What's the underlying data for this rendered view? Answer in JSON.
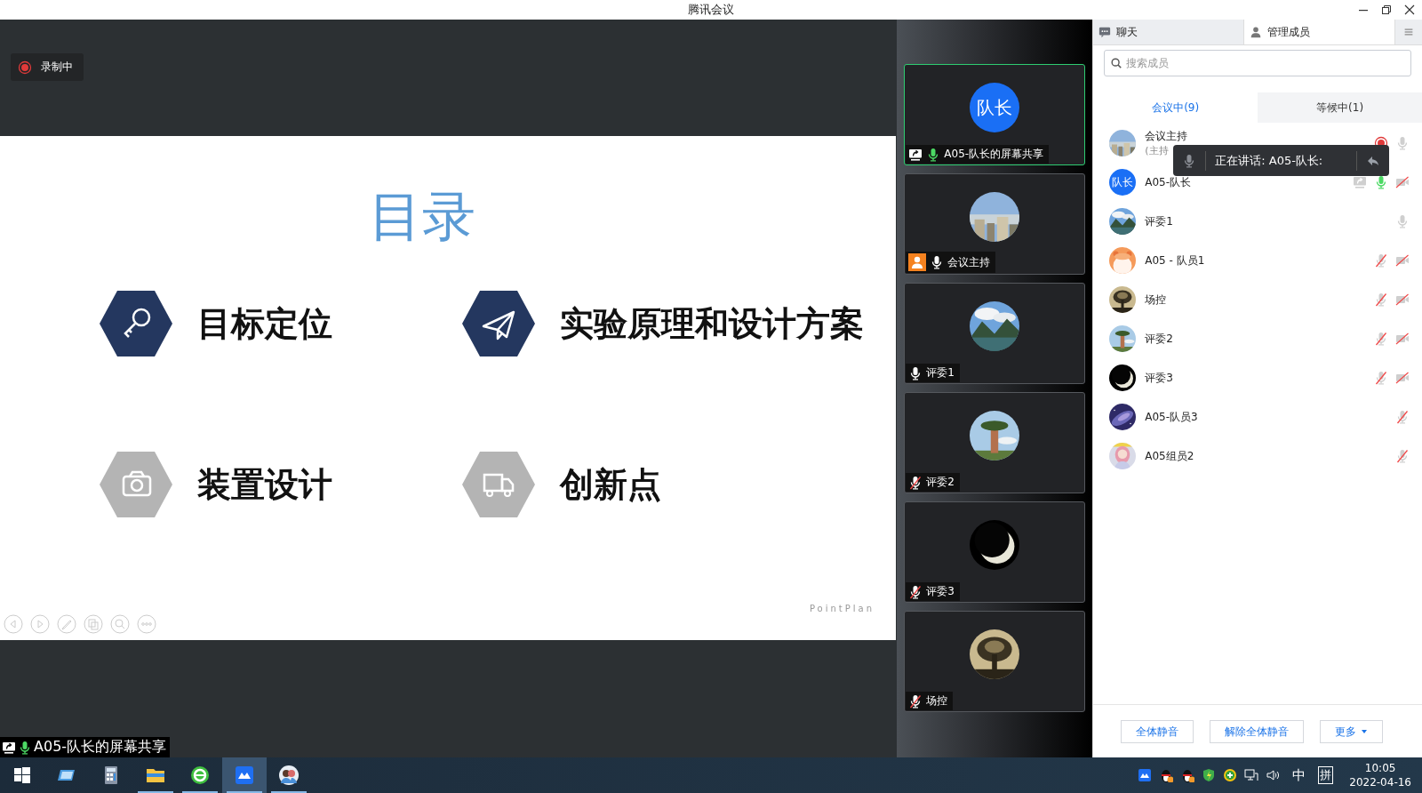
{
  "window": {
    "title": "腾讯会议"
  },
  "recording_badge": {
    "label": "录制中"
  },
  "slide": {
    "heading": "目录",
    "items": [
      {
        "kind": "key",
        "label": "目标定位",
        "color": "#24375f"
      },
      {
        "kind": "plane",
        "label": "实验原理和设计方案",
        "color": "#24375f"
      },
      {
        "kind": "camera",
        "label": "装置设计",
        "color": "#b4b4b4"
      },
      {
        "kind": "truck",
        "label": "创新点",
        "color": "#b4b4b4"
      }
    ],
    "logo": "PointPlan"
  },
  "share_label": {
    "text": "A05-队长的屏幕共享",
    "mic_active": true
  },
  "video_tiles": [
    {
      "name": "A05-队长的屏幕共享",
      "avatar": {
        "kind": "text",
        "text": "队长"
      },
      "speaking": true,
      "host": false,
      "sharing": true,
      "muted": false,
      "mic_active": true
    },
    {
      "name": "会议主持",
      "speaking": false,
      "host": true,
      "sharing": false,
      "muted": false,
      "mic_active": false
    },
    {
      "name": "评委1",
      "speaking": false,
      "host": false,
      "sharing": false,
      "muted": false,
      "mic_active": false
    },
    {
      "name": "评委2",
      "speaking": false,
      "host": false,
      "sharing": false,
      "muted": true,
      "mic_active": false
    },
    {
      "name": "评委3",
      "speaking": false,
      "host": false,
      "sharing": false,
      "muted": true,
      "mic_active": false
    },
    {
      "name": "场控",
      "speaking": false,
      "host": false,
      "sharing": false,
      "muted": true,
      "mic_active": false
    }
  ],
  "panel": {
    "tabs": [
      {
        "kind": "chat",
        "label": "聊天",
        "selected": false
      },
      {
        "kind": "members",
        "label": "管理成员",
        "selected": true
      }
    ],
    "search": {
      "placeholder": "搜索成员"
    },
    "subtabs": [
      {
        "label": "会议中(9)",
        "selected": true
      },
      {
        "label": "等候中(1)",
        "selected": false
      }
    ],
    "participants": [
      {
        "name": "会议主持",
        "subtitle": "(主持",
        "recording": true,
        "sharing": false,
        "muted": false,
        "mic_active": false,
        "camera_off": false
      },
      {
        "name": "A05-队长",
        "avatar": {
          "kind": "text",
          "text": "队长"
        },
        "recording": false,
        "sharing": true,
        "muted": false,
        "mic_active": true,
        "camera_off": true
      },
      {
        "name": "评委1",
        "recording": false,
        "sharing": false,
        "muted": false,
        "mic_active": false,
        "camera_off": false
      },
      {
        "name": "A05 - 队员1",
        "recording": false,
        "sharing": false,
        "muted": true,
        "mic_active": false,
        "camera_off": true
      },
      {
        "name": "场控",
        "recording": false,
        "sharing": false,
        "muted": true,
        "mic_active": false,
        "camera_off": true
      },
      {
        "name": "评委2",
        "recording": false,
        "sharing": false,
        "muted": true,
        "mic_active": false,
        "camera_off": true
      },
      {
        "name": "评委3",
        "recording": false,
        "sharing": false,
        "muted": true,
        "mic_active": false,
        "camera_off": true
      },
      {
        "name": "A05-队员3",
        "recording": false,
        "sharing": false,
        "muted": true,
        "mic_active": false,
        "camera_off": false
      },
      {
        "name": "A05组员2",
        "recording": false,
        "sharing": false,
        "muted": true,
        "mic_active": false,
        "camera_off": false
      }
    ],
    "buttons": [
      {
        "label": "全体静音",
        "kind": "plain"
      },
      {
        "label": "解除全体静音",
        "kind": "plain"
      },
      {
        "label": "更多",
        "kind": "dropdown"
      }
    ]
  },
  "speaking_tooltip": {
    "text": "正在讲话: A05-队长:"
  },
  "taskbar": {
    "apps": [
      {
        "kind": "desktop",
        "running": false,
        "selected": false
      },
      {
        "kind": "calculator",
        "running": false,
        "selected": false
      },
      {
        "kind": "folder",
        "running": true,
        "selected": false
      },
      {
        "kind": "browser",
        "running": true,
        "selected": false
      },
      {
        "kind": "meeting",
        "running": true,
        "selected": true
      },
      {
        "kind": "people",
        "running": true,
        "selected": false
      }
    ],
    "ime": "中",
    "ime_mode": "拼",
    "time": "10:05",
    "date": "2022-04-16"
  }
}
